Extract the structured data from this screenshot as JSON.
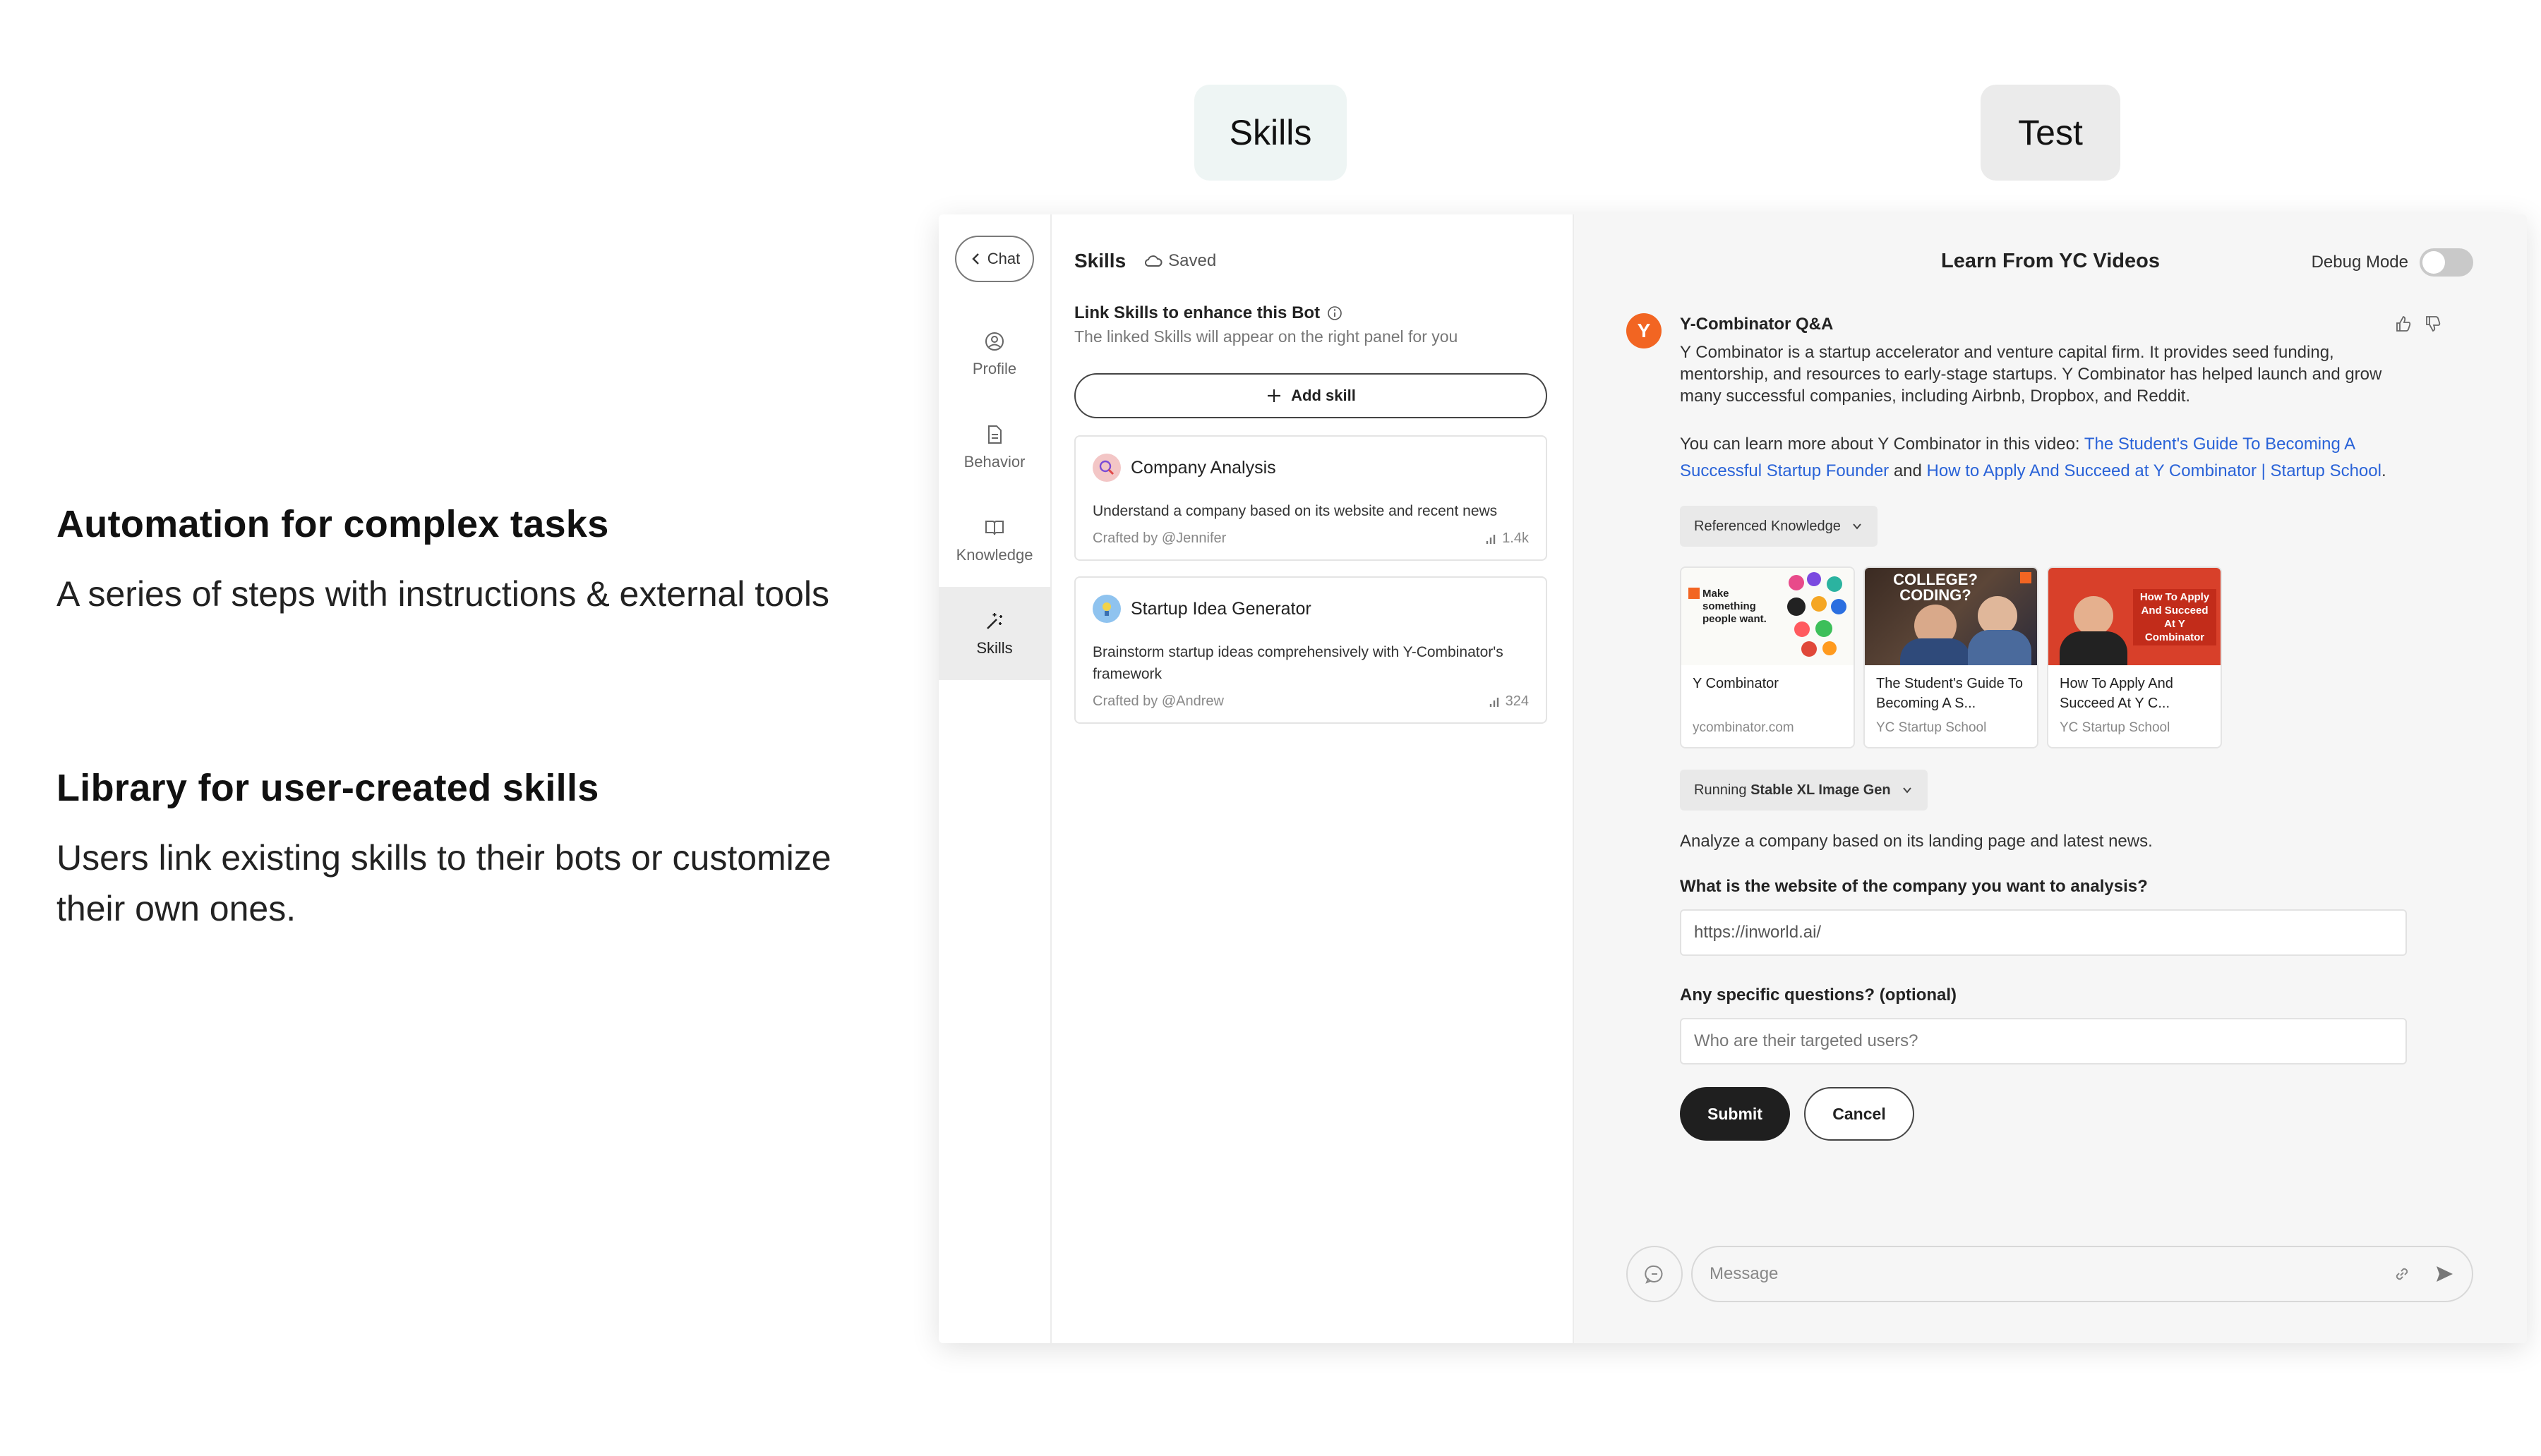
{
  "features": [
    {
      "title": "Automation for complex tasks",
      "body": "A series of steps with instructions & external tools"
    },
    {
      "title": "Library for user-created skills",
      "body": "Users link existing skills to their bots or customize their own ones."
    }
  ],
  "pills": {
    "skills": "Skills",
    "test": "Test"
  },
  "rail": {
    "chat_label": "Chat",
    "items": [
      {
        "label": "Profile",
        "icon": "user-circle-icon"
      },
      {
        "label": "Behavior",
        "icon": "document-icon"
      },
      {
        "label": "Knowledge",
        "icon": "book-icon"
      },
      {
        "label": "Skills",
        "icon": "magic-wand-icon",
        "active": true
      }
    ]
  },
  "skills_panel": {
    "title": "Skills",
    "saved": "Saved",
    "link_title": "Link Skills to enhance this Bot",
    "link_sub": "The linked Skills will appear on the right panel for you",
    "add_skill": "Add skill",
    "cards": [
      {
        "name": "Company Analysis",
        "desc": "Understand a company based on its website and recent news",
        "author": "Crafted by @Jennifer",
        "count": "1.4k"
      },
      {
        "name": "Startup Idea Generator",
        "desc": "Brainstorm startup ideas comprehensively with Y-Combinator's framework",
        "author": "Crafted by @Andrew",
        "count": "324"
      }
    ]
  },
  "test_panel": {
    "title": "Learn From YC Videos",
    "debug_label": "Debug Mode",
    "bot_initial": "Y",
    "bot_name": "Y-Combinator Q&A",
    "message": "Y Combinator is a startup accelerator and venture capital firm. It provides seed funding, mentorship, and resources to early-stage startups. Y Combinator has helped launch and grow many successful companies, including Airbnb, Dropbox, and Reddit.",
    "video_intro": "You can learn more about Y Combinator in this video: ",
    "link1": "The Student's Guide To Becoming A Successful Startup Founder",
    "link_and": " and ",
    "link2": "How to Apply And Succeed at Y Combinator | Startup School",
    "link_end": ".",
    "ref_chip": "Referenced Knowledge",
    "thumbs": [
      {
        "title": "Y Combinator",
        "source": "ycombinator.com",
        "img_text": "Make something people want."
      },
      {
        "title": "The Student's Guide To Becoming A S...",
        "source": "YC Startup School",
        "img_text": "COLLEGE? CODING?"
      },
      {
        "title": "How To Apply And Succeed At Y C...",
        "source": "YC Startup School",
        "img_text": "How To Apply And Succeed At Y Combinator"
      }
    ],
    "run_prefix": "Running ",
    "run_name": "Stable XL Image Gen",
    "analyze": "Analyze a company based on its landing page and latest news.",
    "q1": "What is the website of the company you want to analysis?",
    "q1_value": "https://inworld.ai/",
    "q2": "Any specific questions? (optional)",
    "q2_placeholder": "Who are their targeted users?",
    "submit": "Submit",
    "cancel": "Cancel",
    "composer_placeholder": "Message"
  },
  "colors": {
    "bot_orange": "#f26522",
    "link_blue": "#2a63d8",
    "skills_pill": "#eef5f4",
    "test_pill": "#ebebeb"
  }
}
